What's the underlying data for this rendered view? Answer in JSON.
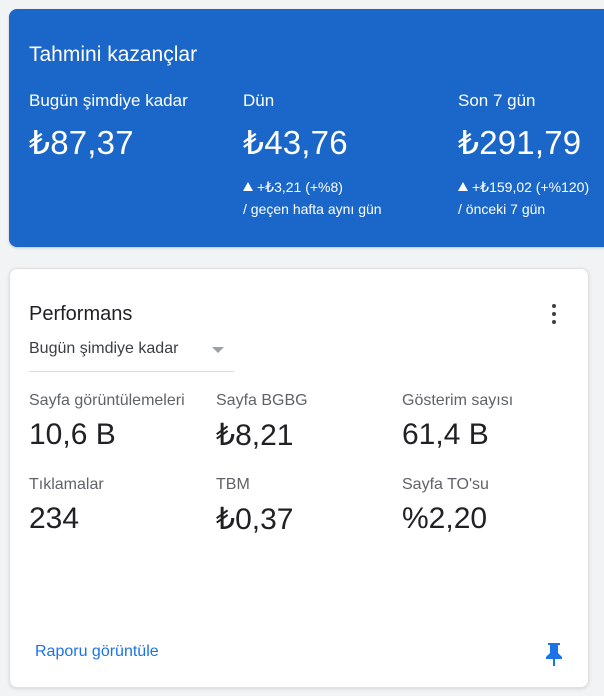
{
  "earnings": {
    "title": "Tahmini kazançlar",
    "accent_color": "#1a66c9",
    "today": {
      "label": "Bugün şimdiye kadar",
      "value": "₺87,37"
    },
    "yesterday": {
      "label": "Dün",
      "value": "₺43,76",
      "change": "+₺3,21 (+%8)",
      "compare": "/ geçen hafta aynı gün"
    },
    "last7": {
      "label": "Son 7 gün",
      "value": "₺291,79",
      "change": "+₺159,02 (+%120)",
      "compare": "/ önceki 7 gün"
    }
  },
  "performance": {
    "title": "Performans",
    "menu_icon": "more-vert-icon",
    "range_selected": "Bugün şimdiye kadar",
    "stats": [
      {
        "label": "Sayfa görüntülemeleri",
        "value": "10,6 B"
      },
      {
        "label": "Sayfa BGBG",
        "value": "₺8,21"
      },
      {
        "label": "Gösterim sayısı",
        "value": "61,4 B"
      },
      {
        "label": "Tıklamalar",
        "value": "234"
      },
      {
        "label": "TBM",
        "value": "₺0,37"
      },
      {
        "label": "Sayfa TO'su",
        "value": "%2,20"
      }
    ],
    "report_link": "Raporu görüntüle",
    "pin_icon": "pin-icon",
    "link_color": "#1a73e8"
  }
}
